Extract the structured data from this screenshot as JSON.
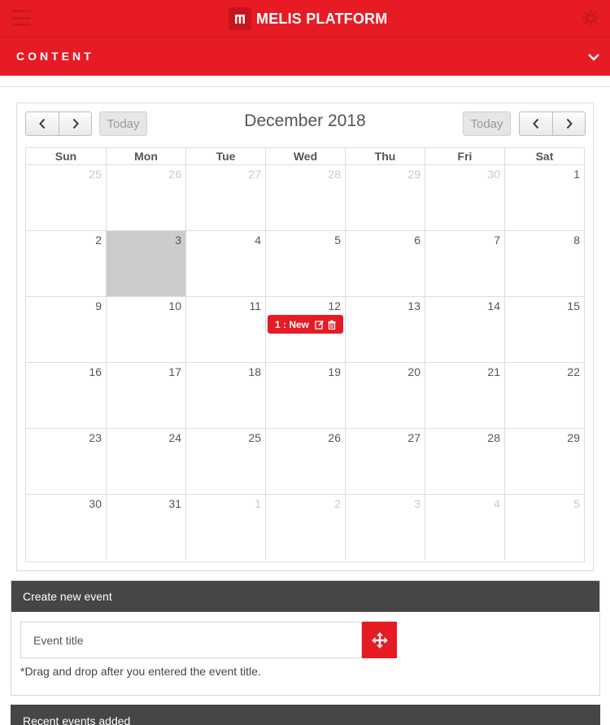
{
  "header": {
    "brand_name": "MELIS PLATFORM",
    "icons": {
      "menu": "hamburger-icon",
      "logo": "melis-logo-icon",
      "settings": "gear-icon"
    },
    "accent_color": "#e61b23"
  },
  "content_bar": {
    "label": "CONTENT",
    "icon": "chevron-down-icon"
  },
  "calendar": {
    "title": "December 2018",
    "today_label": "Today",
    "nav_icons": [
      "chevron-left-icon",
      "chevron-right-icon"
    ],
    "weekdays": [
      "Sun",
      "Mon",
      "Tue",
      "Wed",
      "Thu",
      "Fri",
      "Sat"
    ],
    "weeks": [
      [
        {
          "d": "25",
          "o": true
        },
        {
          "d": "26",
          "o": true
        },
        {
          "d": "27",
          "o": true
        },
        {
          "d": "28",
          "o": true
        },
        {
          "d": "29",
          "o": true
        },
        {
          "d": "30",
          "o": true
        },
        {
          "d": "1"
        }
      ],
      [
        {
          "d": "2"
        },
        {
          "d": "3",
          "today": true
        },
        {
          "d": "4"
        },
        {
          "d": "5"
        },
        {
          "d": "6"
        },
        {
          "d": "7"
        },
        {
          "d": "8"
        }
      ],
      [
        {
          "d": "9"
        },
        {
          "d": "10"
        },
        {
          "d": "11"
        },
        {
          "d": "12"
        },
        {
          "d": "13"
        },
        {
          "d": "14"
        },
        {
          "d": "15"
        }
      ],
      [
        {
          "d": "16"
        },
        {
          "d": "17"
        },
        {
          "d": "18"
        },
        {
          "d": "19"
        },
        {
          "d": "20"
        },
        {
          "d": "21"
        },
        {
          "d": "22"
        }
      ],
      [
        {
          "d": "23"
        },
        {
          "d": "24"
        },
        {
          "d": "25"
        },
        {
          "d": "26"
        },
        {
          "d": "27"
        },
        {
          "d": "28"
        },
        {
          "d": "29"
        }
      ],
      [
        {
          "d": "30"
        },
        {
          "d": "31"
        },
        {
          "d": "1",
          "o": true
        },
        {
          "d": "2",
          "o": true
        },
        {
          "d": "3",
          "o": true
        },
        {
          "d": "4",
          "o": true
        },
        {
          "d": "5",
          "o": true
        }
      ]
    ],
    "events": [
      {
        "week": 2,
        "day": 3,
        "title": "1 : New",
        "icons": [
          "edit-icon",
          "trash-icon"
        ]
      }
    ]
  },
  "create_event": {
    "heading": "Create new event",
    "input_placeholder": "Event title",
    "drag_icon": "move-arrows-icon",
    "note": "*Drag and drop after you entered the event title."
  },
  "recent_events": {
    "heading": "Recent events added"
  }
}
